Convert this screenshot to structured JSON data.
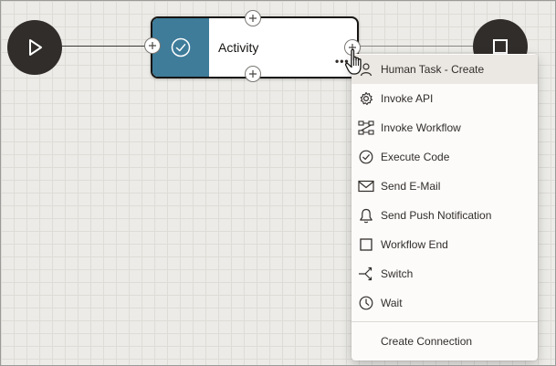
{
  "canvas": {
    "background": "#ecebe7",
    "accent": "#3e7c9a",
    "node_dark": "#312d2a"
  },
  "start_node": {
    "icon": "play-icon"
  },
  "end_node": {
    "icon": "stop-icon"
  },
  "activity": {
    "title": "Activity",
    "icon": "check-circle-icon",
    "more_icon": "more-dots-icon"
  },
  "menu": {
    "items": [
      {
        "label": "Human Task - Create",
        "icon": "person-icon",
        "selected": true
      },
      {
        "label": "Invoke API",
        "icon": "gear-icon"
      },
      {
        "label": "Invoke Workflow",
        "icon": "workflow-icon"
      },
      {
        "label": "Execute Code",
        "icon": "check-circle-icon"
      },
      {
        "label": "Send E-Mail",
        "icon": "envelope-icon"
      },
      {
        "label": "Send Push Notification",
        "icon": "bell-icon"
      },
      {
        "label": "Workflow End",
        "icon": "square-icon"
      },
      {
        "label": "Switch",
        "icon": "switch-icon"
      },
      {
        "label": "Wait",
        "icon": "clock-icon"
      }
    ],
    "footer": "Create Connection"
  }
}
